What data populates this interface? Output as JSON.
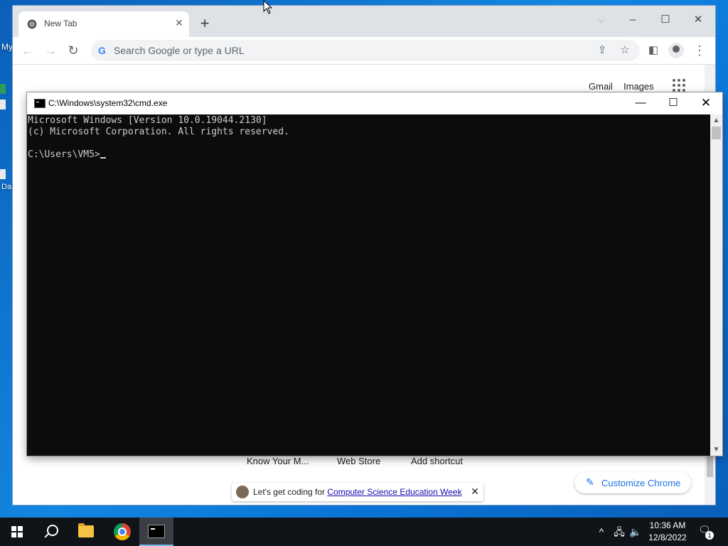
{
  "desktop": {
    "icon_labels": [
      "My",
      "Da"
    ]
  },
  "chrome": {
    "tab": {
      "title": "New Tab"
    },
    "omnibox": {
      "placeholder": "Search Google or type a URL"
    },
    "top_links": [
      "Gmail",
      "Images"
    ],
    "shortcuts": [
      "Know Your M...",
      "Web Store",
      "Add shortcut"
    ],
    "customize_label": "Customize Chrome",
    "promo": {
      "text": "Let's get coding for ",
      "link": "Computer Science Education Week"
    },
    "icons": {
      "back": "back-arrow-icon",
      "forward": "forward-arrow-icon",
      "reload": "reload-icon",
      "share": "share-icon",
      "bookmark": "star-icon",
      "side_panel": "side-panel-icon",
      "profile": "profile-icon",
      "menu": "kebab-menu-icon",
      "apps": "apps-grid-icon",
      "pencil": "pencil-icon",
      "close": "close-icon",
      "new_tab": "plus-icon"
    }
  },
  "cmd": {
    "title": "C:\\Windows\\system32\\cmd.exe",
    "lines": [
      "Microsoft Windows [Version 10.0.19044.2130]",
      "(c) Microsoft Corporation. All rights reserved.",
      "",
      "C:\\Users\\VM5>"
    ]
  },
  "taskbar": {
    "clock_time": "10:36 AM",
    "clock_date": "12/8/2022",
    "notification_count": "1"
  },
  "colors": {
    "console_bg": "#0c0c0c",
    "console_fg": "#cccccc",
    "chrome_accent": "#1a73e8",
    "taskbar_bg": "#101418"
  }
}
